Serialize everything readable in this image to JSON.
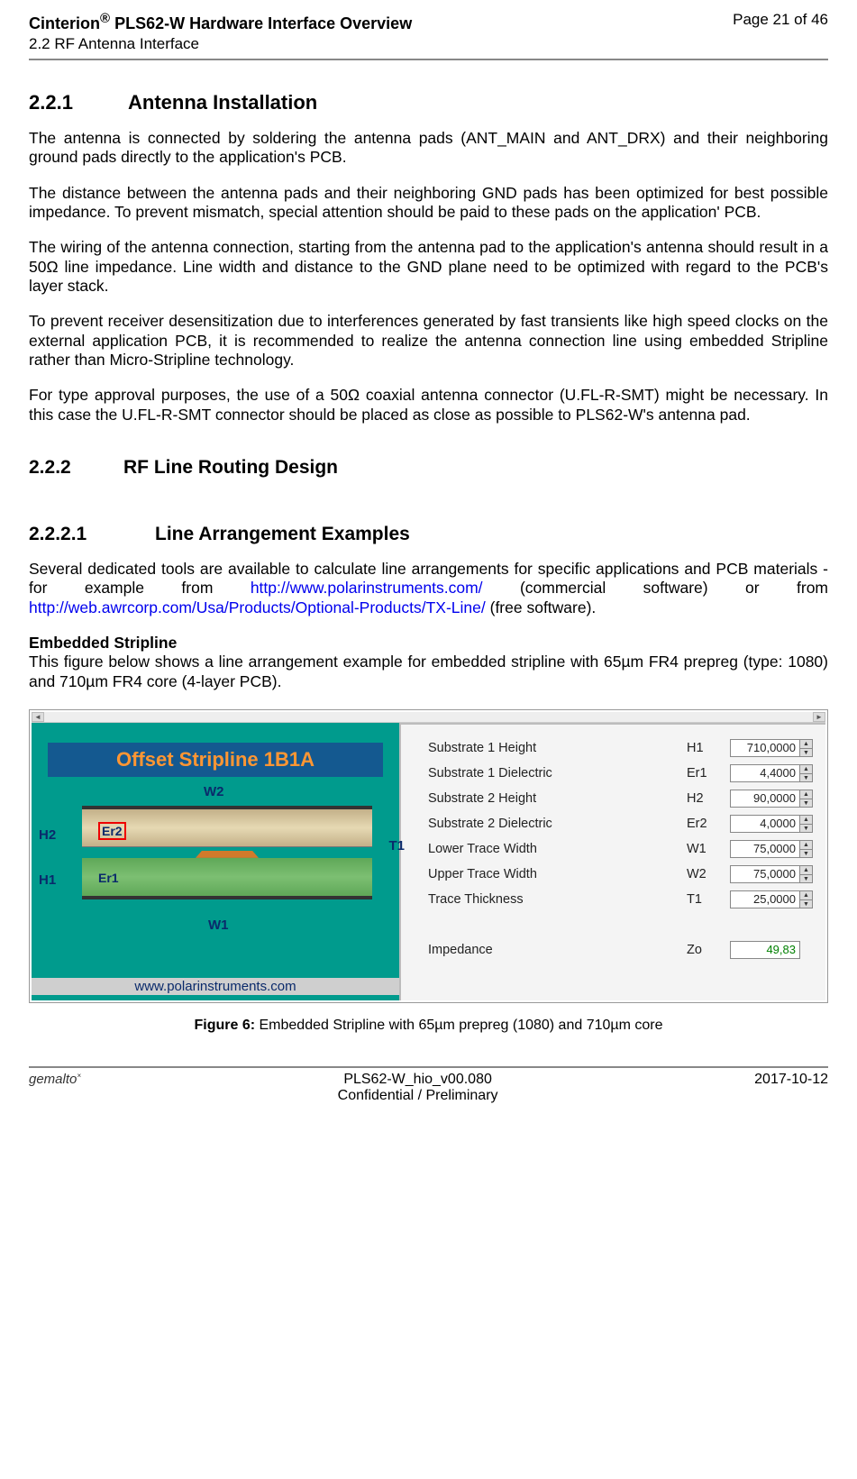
{
  "header": {
    "title_prefix": "Cinterion",
    "reg": "®",
    "title_suffix": " PLS62-W Hardware Interface Overview",
    "subtitle": "2.2 RF Antenna Interface",
    "page": "Page 21 of 46"
  },
  "s221": {
    "num": "2.2.1",
    "title": "Antenna Installation",
    "p1": "The antenna is connected by soldering the antenna pads (ANT_MAIN and ANT_DRX) and their neighboring ground pads directly to the application's PCB.",
    "p2": "The distance between the antenna pads and their neighboring GND pads has been optimized for best possible impedance. To prevent mismatch, special attention should be paid to these pads on the application' PCB.",
    "p3": "The wiring of the antenna connection, starting from the antenna pad to the application's antenna should result in a 50Ω line impedance. Line width and distance to the GND plane need to be optimized with regard to the PCB's layer stack.",
    "p4": "To prevent receiver desensitization due to interferences generated by fast transients like high speed clocks on the external application PCB, it is recommended to realize the antenna connection line using embedded Stripline rather than Micro-Stripline technology.",
    "p5": "For type approval purposes, the use of a 50Ω coaxial antenna connector (U.FL-R-SMT) might be necessary. In this case the U.FL-R-SMT connector should be placed as close as possible to PLS62-W's antenna pad."
  },
  "s222": {
    "num": "2.2.2",
    "title": "RF Line Routing Design"
  },
  "s2221": {
    "num": "2.2.2.1",
    "title": "Line Arrangement Examples",
    "p1a": "Several dedicated tools are available to calculate line arrangements for specific applications and PCB materials - for example from ",
    "link1": "http://www.polarinstruments.com/",
    "p1b": " (commercial software) or  from ",
    "link2": "http://web.awrcorp.com/Usa/Products/Optional-Products/TX-Line/",
    "p1c": "  (free software).",
    "lead": "Embedded Stripline",
    "p2": "This figure below shows a line arrangement example for embedded stripline with 65µm FR4 prepreg (type: 1080) and 710µm FR4 core (4-layer PCB)."
  },
  "figure": {
    "diagram_title": "Offset Stripline 1B1A",
    "labels": {
      "w2": "W2",
      "h2": "H2",
      "h1": "H1",
      "w1": "W1",
      "t1": "T1",
      "er2": "Er2",
      "er1": "Er1"
    },
    "polar_url": "www.polarinstruments.com",
    "params": [
      {
        "label": "Substrate 1 Height",
        "sym": "H1",
        "val": "710,0000"
      },
      {
        "label": "Substrate 1 Dielectric",
        "sym": "Er1",
        "val": "4,4000"
      },
      {
        "label": "Substrate 2 Height",
        "sym": "H2",
        "val": "90,0000"
      },
      {
        "label": "Substrate 2 Dielectric",
        "sym": "Er2",
        "val": "4,0000"
      },
      {
        "label": "Lower Trace Width",
        "sym": "W1",
        "val": "75,0000"
      },
      {
        "label": "Upper Trace Width",
        "sym": "W2",
        "val": "75,0000"
      },
      {
        "label": "Trace Thickness",
        "sym": "T1",
        "val": "25,0000"
      }
    ],
    "impedance": {
      "label": "Impedance",
      "sym": "Zo",
      "val": "49,83"
    },
    "caption_bold": "Figure 6:",
    "caption_rest": "  Embedded Stripline with 65µm prepreg (1080) and 710µm core"
  },
  "footer": {
    "brand": "gemalto",
    "tm": "×",
    "doc": "PLS62-W_hio_v00.080",
    "conf": "Confidential / Preliminary",
    "date": "2017-10-12"
  }
}
